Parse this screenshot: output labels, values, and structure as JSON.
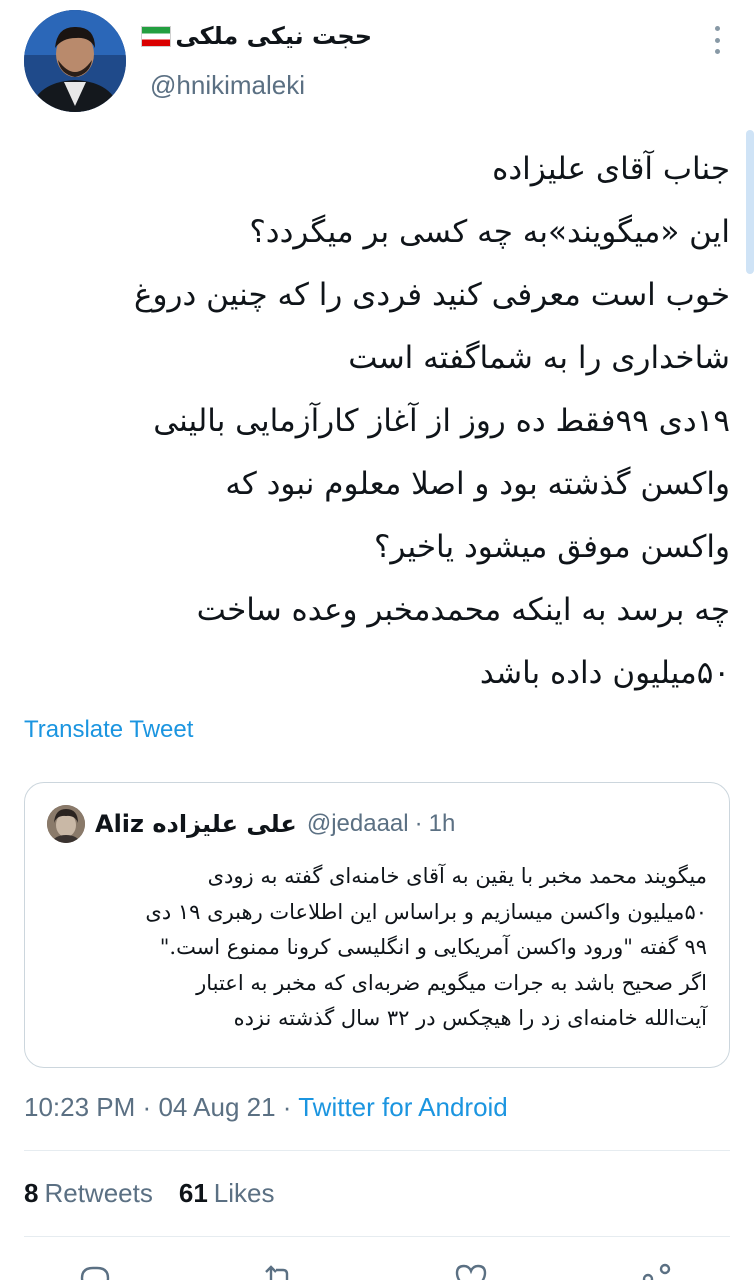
{
  "author": {
    "display_name": "حجت نیکی ملکی",
    "handle": "@hnikimaleki",
    "avatar_icon": "user-avatar",
    "flag_icon": "iran-flag-icon"
  },
  "tweet": {
    "lines": [
      "جناب آقای علیزاده",
      "این «میگویند»به چه کسی بر میگردد؟",
      "خوب است معرفی کنید فردی را که چنین دروغ",
      "شاخداری را به شماگفته است",
      "۱۹دی ۹۹فقط ده روز از آغاز کارآزمایی بالینی",
      "واکسن گذشته بود و اصلا معلوم نبود که",
      "واکسن موفق میشود یاخیر؟",
      "چه برسد به اینکه محمدمخبر وعده ساخت",
      "۵۰میلیون داده باشد"
    ],
    "translate_label": "Translate Tweet"
  },
  "quoted": {
    "display_name": "Aliz علی علیزاده",
    "handle": "@jedaaal",
    "separator": "·",
    "time": "1h",
    "lines": [
      "میگویند محمد مخبر با یقین به آقای خامنه‌ای گفته به زودی",
      "۵۰میلیون واکسن میسازیم و براساس این اطلاعات رهبری ۱۹ دی",
      "۹۹ گفته \"ورود واکسن آمریکایی و انگلیسی کرونا ممنوع است.\"",
      "اگر صحیح باشد به جرات میگویم ضربه‌ای که مخبر به اعتبار",
      "آیت‌الله خامنه‌ای زد را هیچکس در ۳۲ سال گذشته نزده"
    ]
  },
  "meta": {
    "time": "10:23 PM",
    "dot1": "·",
    "date": "04 Aug 21",
    "dot2": "·",
    "source": "Twitter for Android"
  },
  "stats": {
    "retweets_count": "8",
    "retweets_label": "Retweets",
    "likes_count": "61",
    "likes_label": "Likes"
  },
  "actions": [
    "reply-icon",
    "retweet-icon",
    "like-icon",
    "share-icon"
  ],
  "colors": {
    "link": "#1b95e0",
    "secondary_text": "#5b7083",
    "primary_text": "#0f1419",
    "border": "#ccd6dd"
  }
}
